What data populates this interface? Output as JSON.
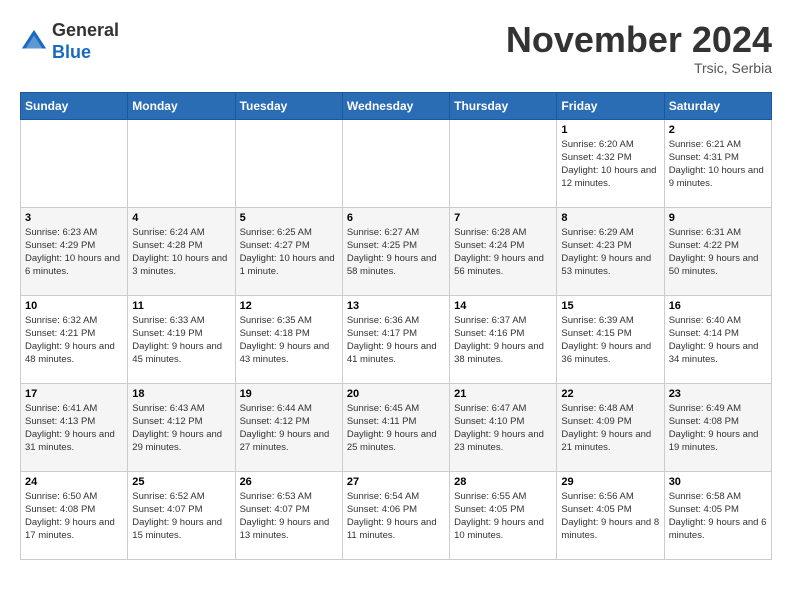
{
  "header": {
    "logo_line1": "General",
    "logo_line2": "Blue",
    "month": "November 2024",
    "location": "Trsic, Serbia"
  },
  "weekdays": [
    "Sunday",
    "Monday",
    "Tuesday",
    "Wednesday",
    "Thursday",
    "Friday",
    "Saturday"
  ],
  "weeks": [
    [
      {
        "day": "",
        "info": ""
      },
      {
        "day": "",
        "info": ""
      },
      {
        "day": "",
        "info": ""
      },
      {
        "day": "",
        "info": ""
      },
      {
        "day": "",
        "info": ""
      },
      {
        "day": "1",
        "info": "Sunrise: 6:20 AM\nSunset: 4:32 PM\nDaylight: 10 hours and 12 minutes."
      },
      {
        "day": "2",
        "info": "Sunrise: 6:21 AM\nSunset: 4:31 PM\nDaylight: 10 hours and 9 minutes."
      }
    ],
    [
      {
        "day": "3",
        "info": "Sunrise: 6:23 AM\nSunset: 4:29 PM\nDaylight: 10 hours and 6 minutes."
      },
      {
        "day": "4",
        "info": "Sunrise: 6:24 AM\nSunset: 4:28 PM\nDaylight: 10 hours and 3 minutes."
      },
      {
        "day": "5",
        "info": "Sunrise: 6:25 AM\nSunset: 4:27 PM\nDaylight: 10 hours and 1 minute."
      },
      {
        "day": "6",
        "info": "Sunrise: 6:27 AM\nSunset: 4:25 PM\nDaylight: 9 hours and 58 minutes."
      },
      {
        "day": "7",
        "info": "Sunrise: 6:28 AM\nSunset: 4:24 PM\nDaylight: 9 hours and 56 minutes."
      },
      {
        "day": "8",
        "info": "Sunrise: 6:29 AM\nSunset: 4:23 PM\nDaylight: 9 hours and 53 minutes."
      },
      {
        "day": "9",
        "info": "Sunrise: 6:31 AM\nSunset: 4:22 PM\nDaylight: 9 hours and 50 minutes."
      }
    ],
    [
      {
        "day": "10",
        "info": "Sunrise: 6:32 AM\nSunset: 4:21 PM\nDaylight: 9 hours and 48 minutes."
      },
      {
        "day": "11",
        "info": "Sunrise: 6:33 AM\nSunset: 4:19 PM\nDaylight: 9 hours and 45 minutes."
      },
      {
        "day": "12",
        "info": "Sunrise: 6:35 AM\nSunset: 4:18 PM\nDaylight: 9 hours and 43 minutes."
      },
      {
        "day": "13",
        "info": "Sunrise: 6:36 AM\nSunset: 4:17 PM\nDaylight: 9 hours and 41 minutes."
      },
      {
        "day": "14",
        "info": "Sunrise: 6:37 AM\nSunset: 4:16 PM\nDaylight: 9 hours and 38 minutes."
      },
      {
        "day": "15",
        "info": "Sunrise: 6:39 AM\nSunset: 4:15 PM\nDaylight: 9 hours and 36 minutes."
      },
      {
        "day": "16",
        "info": "Sunrise: 6:40 AM\nSunset: 4:14 PM\nDaylight: 9 hours and 34 minutes."
      }
    ],
    [
      {
        "day": "17",
        "info": "Sunrise: 6:41 AM\nSunset: 4:13 PM\nDaylight: 9 hours and 31 minutes."
      },
      {
        "day": "18",
        "info": "Sunrise: 6:43 AM\nSunset: 4:12 PM\nDaylight: 9 hours and 29 minutes."
      },
      {
        "day": "19",
        "info": "Sunrise: 6:44 AM\nSunset: 4:12 PM\nDaylight: 9 hours and 27 minutes."
      },
      {
        "day": "20",
        "info": "Sunrise: 6:45 AM\nSunset: 4:11 PM\nDaylight: 9 hours and 25 minutes."
      },
      {
        "day": "21",
        "info": "Sunrise: 6:47 AM\nSunset: 4:10 PM\nDaylight: 9 hours and 23 minutes."
      },
      {
        "day": "22",
        "info": "Sunrise: 6:48 AM\nSunset: 4:09 PM\nDaylight: 9 hours and 21 minutes."
      },
      {
        "day": "23",
        "info": "Sunrise: 6:49 AM\nSunset: 4:08 PM\nDaylight: 9 hours and 19 minutes."
      }
    ],
    [
      {
        "day": "24",
        "info": "Sunrise: 6:50 AM\nSunset: 4:08 PM\nDaylight: 9 hours and 17 minutes."
      },
      {
        "day": "25",
        "info": "Sunrise: 6:52 AM\nSunset: 4:07 PM\nDaylight: 9 hours and 15 minutes."
      },
      {
        "day": "26",
        "info": "Sunrise: 6:53 AM\nSunset: 4:07 PM\nDaylight: 9 hours and 13 minutes."
      },
      {
        "day": "27",
        "info": "Sunrise: 6:54 AM\nSunset: 4:06 PM\nDaylight: 9 hours and 11 minutes."
      },
      {
        "day": "28",
        "info": "Sunrise: 6:55 AM\nSunset: 4:05 PM\nDaylight: 9 hours and 10 minutes."
      },
      {
        "day": "29",
        "info": "Sunrise: 6:56 AM\nSunset: 4:05 PM\nDaylight: 9 hours and 8 minutes."
      },
      {
        "day": "30",
        "info": "Sunrise: 6:58 AM\nSunset: 4:05 PM\nDaylight: 9 hours and 6 minutes."
      }
    ]
  ]
}
